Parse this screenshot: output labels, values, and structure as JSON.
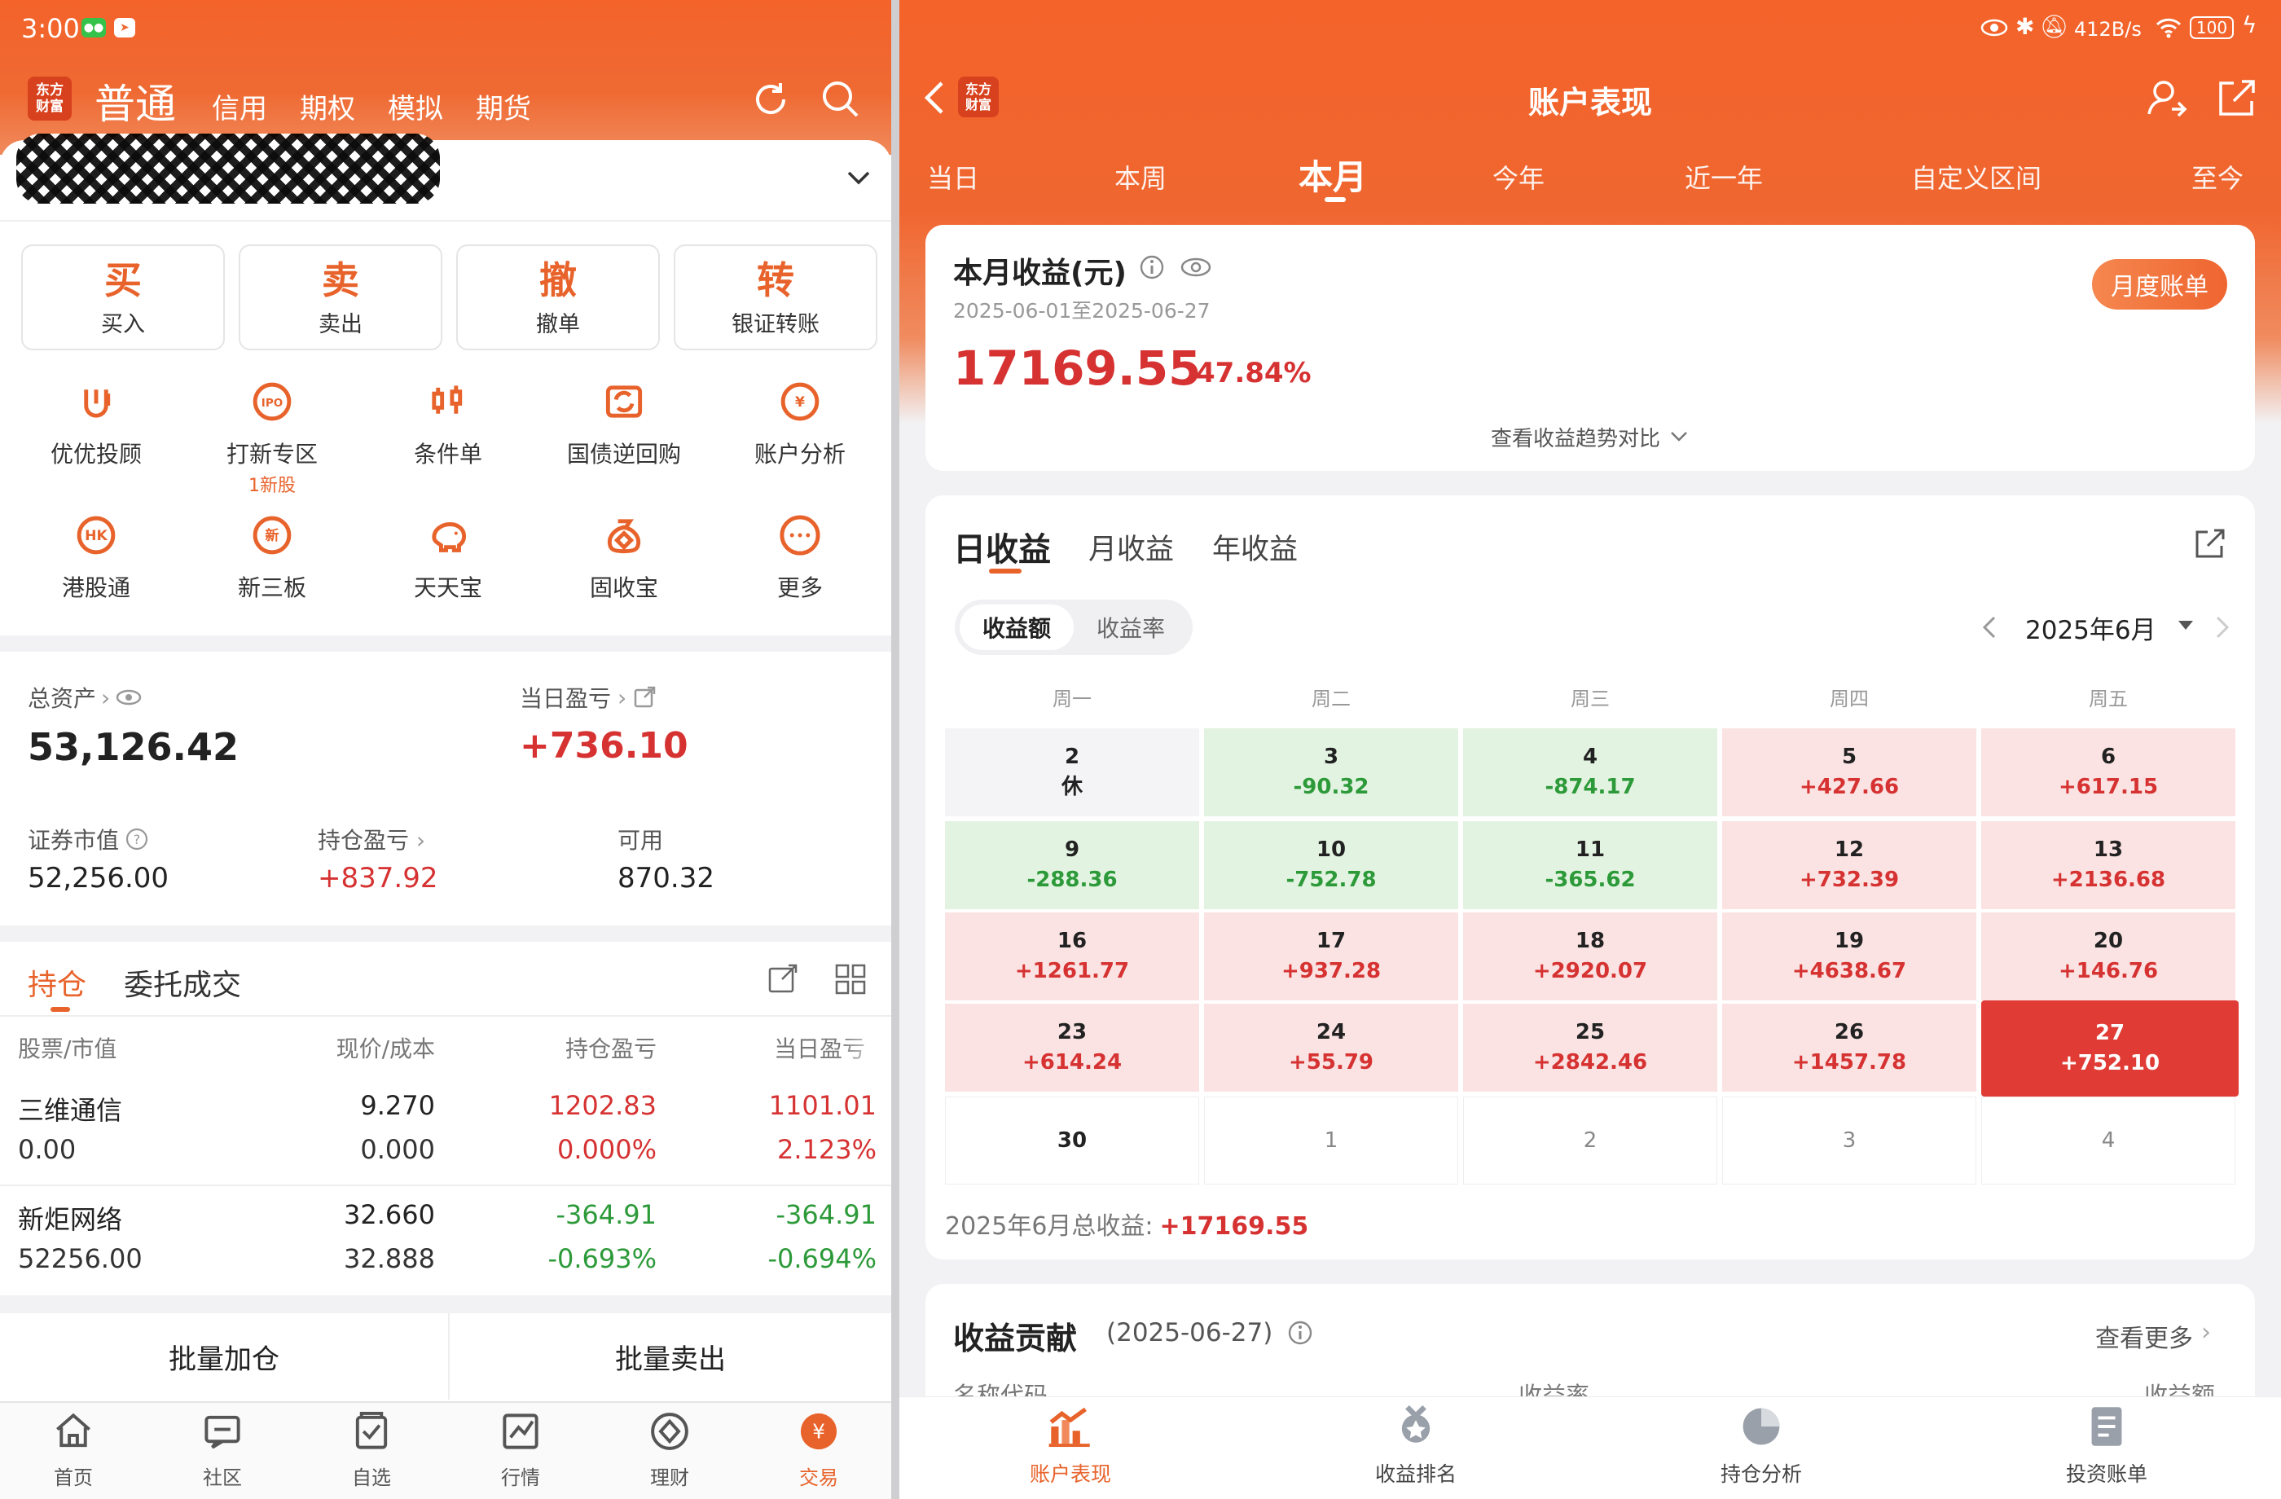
{
  "status_bar": {
    "time": "3:00",
    "net_speed": "412B/s",
    "battery": "100"
  },
  "left": {
    "logo_text_1": "东方",
    "logo_text_2": "财富",
    "top_tabs": [
      "普通",
      "信用",
      "期权",
      "模拟",
      "期货"
    ],
    "actions": [
      {
        "big": "买",
        "small": "买入"
      },
      {
        "big": "卖",
        "small": "卖出"
      },
      {
        "big": "撤",
        "small": "撤单"
      },
      {
        "big": "转",
        "small": "银证转账"
      }
    ],
    "grid_row1": [
      {
        "label": "优优投顾",
        "icon": "uu-advisor-icon"
      },
      {
        "label": "打新专区",
        "sub": "1新股",
        "icon": "ipo-icon",
        "icon_text": "IPO"
      },
      {
        "label": "条件单",
        "icon": "condition-order-icon"
      },
      {
        "label": "国债逆回购",
        "icon": "reverse-repo-icon"
      },
      {
        "label": "账户分析",
        "icon": "account-analysis-icon",
        "icon_text": "¥"
      }
    ],
    "grid_row2": [
      {
        "label": "港股通",
        "icon": "hk-connect-icon",
        "icon_text": "HK"
      },
      {
        "label": "新三板",
        "icon": "neeq-icon",
        "icon_text": "新"
      },
      {
        "label": "天天宝",
        "icon": "piggy-bank-icon"
      },
      {
        "label": "固收宝",
        "icon": "money-bag-icon"
      },
      {
        "label": "更多",
        "icon": "more-icon"
      }
    ],
    "assets": {
      "total_label": "总资产",
      "total_value": "53,126.42",
      "daily_label": "当日盈亏",
      "daily_value": "+736.10",
      "market_label": "证券市值",
      "market_value": "52,256.00",
      "hold_pl_label": "持仓盈亏",
      "hold_pl_value": "+837.92",
      "avail_label": "可用",
      "avail_value": "870.32"
    },
    "position_tabs": [
      "持仓",
      "委托成交"
    ],
    "table_headers": [
      "股票/市值",
      "现价/成本",
      "持仓盈亏",
      "当日盈亏"
    ],
    "rows": [
      {
        "name": "三维通信",
        "mv": "0.00",
        "price": "9.270",
        "cost": "0.000",
        "pl": "1202.83",
        "pl_pct": "0.000%",
        "day": "1101.01",
        "day_pct": "2.123%",
        "sign": "pos"
      },
      {
        "name": "新炬网络",
        "mv": "52256.00",
        "price": "32.660",
        "cost": "32.888",
        "pl": "-364.91",
        "pl_pct": "-0.693%",
        "day": "-364.91",
        "day_pct": "-0.694%",
        "sign": "neg"
      }
    ],
    "batch_add": "批量加仓",
    "batch_sell": "批量卖出",
    "bottom_nav": [
      {
        "label": "首页",
        "icon": "home-icon"
      },
      {
        "label": "社区",
        "icon": "community-icon"
      },
      {
        "label": "自选",
        "icon": "watchlist-icon"
      },
      {
        "label": "行情",
        "icon": "market-icon"
      },
      {
        "label": "理财",
        "icon": "finance-icon"
      },
      {
        "label": "交易",
        "icon": "trade-icon"
      }
    ]
  },
  "right": {
    "title": "账户表现",
    "period_tabs": [
      "当日",
      "本周",
      "本月",
      "今年",
      "近一年",
      "自定义区间",
      "至今"
    ],
    "summary": {
      "title": "本月收益(元)",
      "range": "2025-06-01至2025-06-27",
      "amount": "17169.55",
      "rate": "47.84%",
      "monthly_bill": "月度账单",
      "trend_link": "查看收益趋势对比"
    },
    "earn_tabs": [
      "日收益",
      "月收益",
      "年收益"
    ],
    "toggle": [
      "收益额",
      "收益率"
    ],
    "month": "2025年6月",
    "weekdays": [
      "周一",
      "周二",
      "周三",
      "周四",
      "周五"
    ],
    "calendar": [
      [
        {
          "d": "2",
          "v": "休",
          "t": "rest"
        },
        {
          "d": "3",
          "v": "-90.32",
          "t": "neg"
        },
        {
          "d": "4",
          "v": "-874.17",
          "t": "neg"
        },
        {
          "d": "5",
          "v": "+427.66",
          "t": "pos"
        },
        {
          "d": "6",
          "v": "+617.15",
          "t": "pos"
        }
      ],
      [
        {
          "d": "9",
          "v": "-288.36",
          "t": "neg"
        },
        {
          "d": "10",
          "v": "-752.78",
          "t": "neg"
        },
        {
          "d": "11",
          "v": "-365.62",
          "t": "neg"
        },
        {
          "d": "12",
          "v": "+732.39",
          "t": "pos"
        },
        {
          "d": "13",
          "v": "+2136.68",
          "t": "pos"
        }
      ],
      [
        {
          "d": "16",
          "v": "+1261.77",
          "t": "pos"
        },
        {
          "d": "17",
          "v": "+937.28",
          "t": "pos"
        },
        {
          "d": "18",
          "v": "+2920.07",
          "t": "pos"
        },
        {
          "d": "19",
          "v": "+4638.67",
          "t": "pos"
        },
        {
          "d": "20",
          "v": "+146.76",
          "t": "pos"
        }
      ],
      [
        {
          "d": "23",
          "v": "+614.24",
          "t": "pos"
        },
        {
          "d": "24",
          "v": "+55.79",
          "t": "pos"
        },
        {
          "d": "25",
          "v": "+2842.46",
          "t": "pos"
        },
        {
          "d": "26",
          "v": "+1457.78",
          "t": "pos"
        },
        {
          "d": "27",
          "v": "+752.10",
          "t": "sel"
        }
      ],
      [
        {
          "d": "30",
          "v": "",
          "t": "empty"
        },
        {
          "d": "1",
          "v": "",
          "t": "next"
        },
        {
          "d": "2",
          "v": "",
          "t": "next"
        },
        {
          "d": "3",
          "v": "",
          "t": "next"
        },
        {
          "d": "4",
          "v": "",
          "t": "next"
        }
      ]
    ],
    "total_label": "2025年6月总收益:",
    "total_value": "+17169.55",
    "contrib": {
      "title": "收益贡献",
      "date": "(2025-06-27)",
      "more": "查看更多",
      "col1": "名称代码",
      "col2": "收益率",
      "col3": "收益额"
    },
    "bottom_nav": [
      {
        "label": "账户表现",
        "icon": "performance-icon"
      },
      {
        "label": "收益排名",
        "icon": "ranking-icon"
      },
      {
        "label": "持仓分析",
        "icon": "position-analysis-icon"
      },
      {
        "label": "投资账单",
        "icon": "invest-bill-icon"
      }
    ]
  },
  "colors": {
    "brand": "#e8632b",
    "up": "#d63232",
    "down": "#2d9a3a",
    "up_bg": "#fbe3e3",
    "down_bg": "#e3f3e1",
    "selected": "#e03b35"
  }
}
